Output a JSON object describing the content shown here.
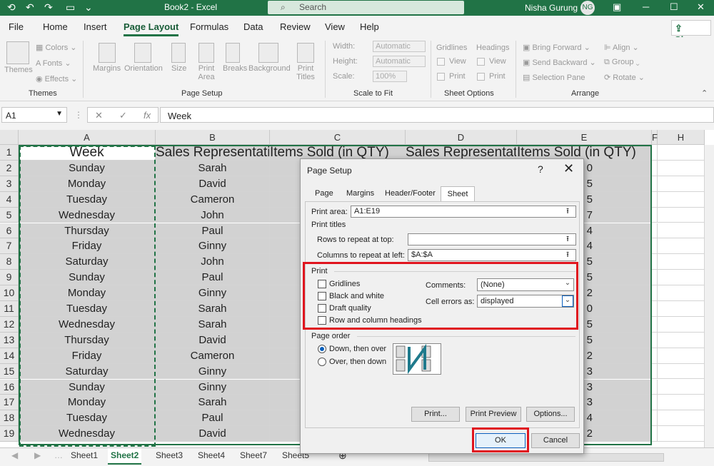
{
  "app": {
    "title": "Book2  -  Excel",
    "search_placeholder": "Search",
    "user_name": "Nisha Gurung",
    "user_initials": "NG",
    "share_label": "Share",
    "window_buttons": [
      "─",
      "☐",
      "✕"
    ],
    "accent_color": "#217346"
  },
  "menu": {
    "tabs": [
      "File",
      "Home",
      "Insert",
      "Page Layout",
      "Formulas",
      "Data",
      "Review",
      "View",
      "Help"
    ],
    "active_tab": "Page Layout"
  },
  "ribbon": {
    "themes": {
      "themes_label": "Themes",
      "colors": "Colors",
      "fonts": "Fonts",
      "effects": "Effects",
      "group": "Themes"
    },
    "page_setup": {
      "buttons": [
        "Margins",
        "Orientation",
        "Size",
        "Print Area",
        "Breaks",
        "Background",
        "Print Titles"
      ],
      "group": "Page Setup"
    },
    "scale_to_fit": {
      "width_label": "Width:",
      "width_value": "Automatic",
      "height_label": "Height:",
      "height_value": "Automatic",
      "scale_label": "Scale:",
      "scale_value": "100%",
      "group": "Scale to Fit"
    },
    "sheet_options": {
      "gridlines": "Gridlines",
      "headings": "Headings",
      "view": "View",
      "print": "Print",
      "group": "Sheet Options"
    },
    "arrange": {
      "bring_forward": "Bring Forward",
      "send_backward": "Send Backward",
      "selection_pane": "Selection Pane",
      "align": "Align",
      "group_btn": "Group",
      "rotate": "Rotate",
      "group": "Arrange"
    }
  },
  "formula_bar": {
    "name_box": "A1",
    "cancel": "✕",
    "enter": "✓",
    "fx": "fx",
    "content": "Week"
  },
  "grid": {
    "columns": [
      "A",
      "B",
      "C",
      "D",
      "E",
      "F",
      "H"
    ],
    "header_row": [
      "Week",
      "Sales Representative",
      "Items Sold (in QTY)",
      "Sales Representative",
      "Items Sold (in QTY)"
    ],
    "rows": [
      [
        "Sunday",
        "Sarah",
        "0"
      ],
      [
        "Monday",
        "David",
        "5"
      ],
      [
        "Tuesday",
        "Cameron",
        "5"
      ],
      [
        "Wednesday",
        "John",
        "7"
      ],
      [
        "Thursday",
        "Paul",
        "4"
      ],
      [
        "Friday",
        "Ginny",
        "4"
      ],
      [
        "Saturday",
        "John",
        "5"
      ],
      [
        "Sunday",
        "Paul",
        "5"
      ],
      [
        "Monday",
        "Ginny",
        "2"
      ],
      [
        "Tuesday",
        "Sarah",
        "0"
      ],
      [
        "Wednesday",
        "Sarah",
        "5"
      ],
      [
        "Thursday",
        "David",
        "5"
      ],
      [
        "Friday",
        "Cameron",
        "2"
      ],
      [
        "Saturday",
        "Ginny",
        "3"
      ],
      [
        "Sunday",
        "Ginny",
        "3"
      ],
      [
        "Monday",
        "Sarah",
        "3"
      ],
      [
        "Tuesday",
        "Paul",
        "4"
      ],
      [
        "Wednesday",
        "David",
        "2"
      ]
    ],
    "row_numbers": [
      "1",
      "2",
      "3",
      "4",
      "5",
      "6",
      "7",
      "8",
      "9",
      "10",
      "11",
      "12",
      "13",
      "14",
      "15",
      "16",
      "17",
      "18",
      "19"
    ]
  },
  "sheets": {
    "tabs": [
      "Sheet1",
      "Sheet2",
      "Sheet3",
      "Sheet4",
      "Sheet7",
      "Sheet5"
    ],
    "active": "Sheet2",
    "add": "⊕"
  },
  "dialog": {
    "title": "Page Setup",
    "help": "?",
    "close": "✕",
    "tabs": [
      "Page",
      "Margins",
      "Header/Footer",
      "Sheet"
    ],
    "active_tab": "Sheet",
    "print_area_label": "Print area:",
    "print_area_value": "A1:E19",
    "print_titles_label": "Print titles",
    "rows_repeat_label": "Rows to repeat at top:",
    "rows_repeat_value": "",
    "cols_repeat_label": "Columns to repeat at left:",
    "cols_repeat_value": "$A:$A",
    "print_section": "Print",
    "gridlines": "Gridlines",
    "black_white": "Black and white",
    "draft_quality": "Draft quality",
    "row_col_headings": "Row and column headings",
    "comments_label": "Comments:",
    "comments_value": "(None)",
    "cell_errors_label": "Cell errors as:",
    "cell_errors_value": "displayed",
    "page_order_label": "Page order",
    "down_then_over": "Down, then over",
    "over_then_down": "Over, then down",
    "print_btn": "Print...",
    "print_preview_btn": "Print Preview",
    "options_btn": "Options...",
    "ok_btn": "OK",
    "cancel_btn": "Cancel",
    "highlight_color": "#e0141e"
  }
}
